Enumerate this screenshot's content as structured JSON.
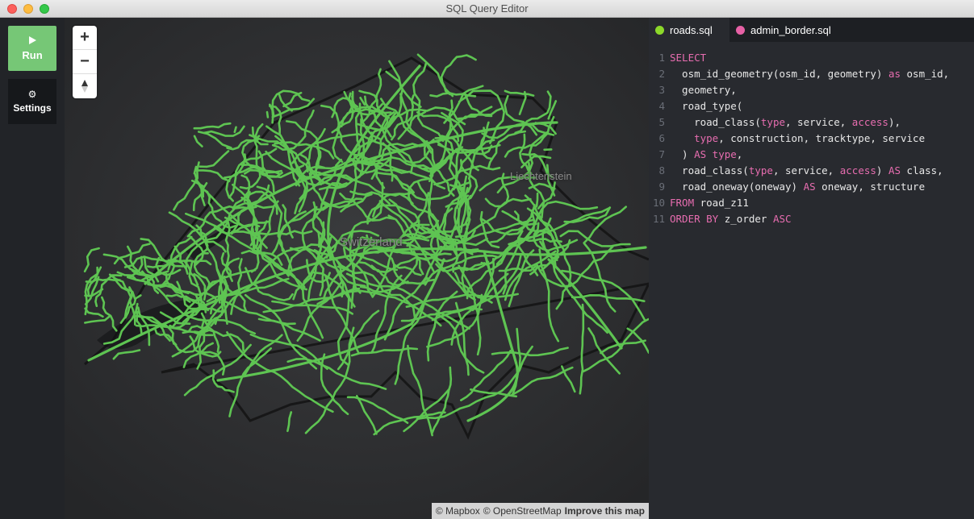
{
  "window": {
    "title": "SQL Query Editor"
  },
  "sidebar": {
    "run_label": "Run",
    "settings_label": "Settings"
  },
  "map": {
    "zoom_in": "+",
    "zoom_out": "−",
    "labels": {
      "country": "Switzerland",
      "region": "Liechtenstein"
    },
    "attribution": {
      "mapbox": "© Mapbox",
      "osm": "© OpenStreetMap",
      "improve": "Improve this map"
    },
    "road_color": "#5ec452"
  },
  "editor": {
    "tabs": [
      {
        "label": "roads.sql",
        "color": "#8cd82a",
        "active": true
      },
      {
        "label": "admin_border.sql",
        "color": "#e661a5",
        "active": false
      }
    ],
    "lines": [
      {
        "n": "1",
        "tokens": [
          {
            "t": "SELECT",
            "k": true
          }
        ]
      },
      {
        "n": "2",
        "tokens": [
          {
            "t": "  osm_id_geometry(osm_id, geometry) "
          },
          {
            "t": "as",
            "k": true
          },
          {
            "t": " osm_id,"
          }
        ]
      },
      {
        "n": "3",
        "tokens": [
          {
            "t": "  geometry,"
          }
        ]
      },
      {
        "n": "4",
        "tokens": [
          {
            "t": "  road_type("
          }
        ]
      },
      {
        "n": "5",
        "tokens": [
          {
            "t": "    road_class("
          },
          {
            "t": "type",
            "k": true
          },
          {
            "t": ", service, "
          },
          {
            "t": "access",
            "k": true
          },
          {
            "t": "),"
          }
        ]
      },
      {
        "n": "6",
        "tokens": [
          {
            "t": "    "
          },
          {
            "t": "type",
            "k": true
          },
          {
            "t": ", construction, tracktype, service"
          }
        ]
      },
      {
        "n": "7",
        "tokens": [
          {
            "t": "  ) "
          },
          {
            "t": "AS type",
            "k": true
          },
          {
            "t": ","
          }
        ]
      },
      {
        "n": "8",
        "tokens": [
          {
            "t": "  road_class("
          },
          {
            "t": "type",
            "k": true
          },
          {
            "t": ", service, "
          },
          {
            "t": "access",
            "k": true
          },
          {
            "t": ") "
          },
          {
            "t": "AS",
            "k": true
          },
          {
            "t": " class,"
          }
        ]
      },
      {
        "n": "9",
        "tokens": [
          {
            "t": "  road_oneway(oneway) "
          },
          {
            "t": "AS",
            "k": true
          },
          {
            "t": " oneway, structure"
          }
        ]
      },
      {
        "n": "10",
        "tokens": [
          {
            "t": "FROM",
            "k": true
          },
          {
            "t": " road_z11"
          }
        ]
      },
      {
        "n": "11",
        "tokens": [
          {
            "t": "ORDER BY",
            "k": true
          },
          {
            "t": " z_order "
          },
          {
            "t": "ASC",
            "k": true
          }
        ]
      }
    ]
  }
}
